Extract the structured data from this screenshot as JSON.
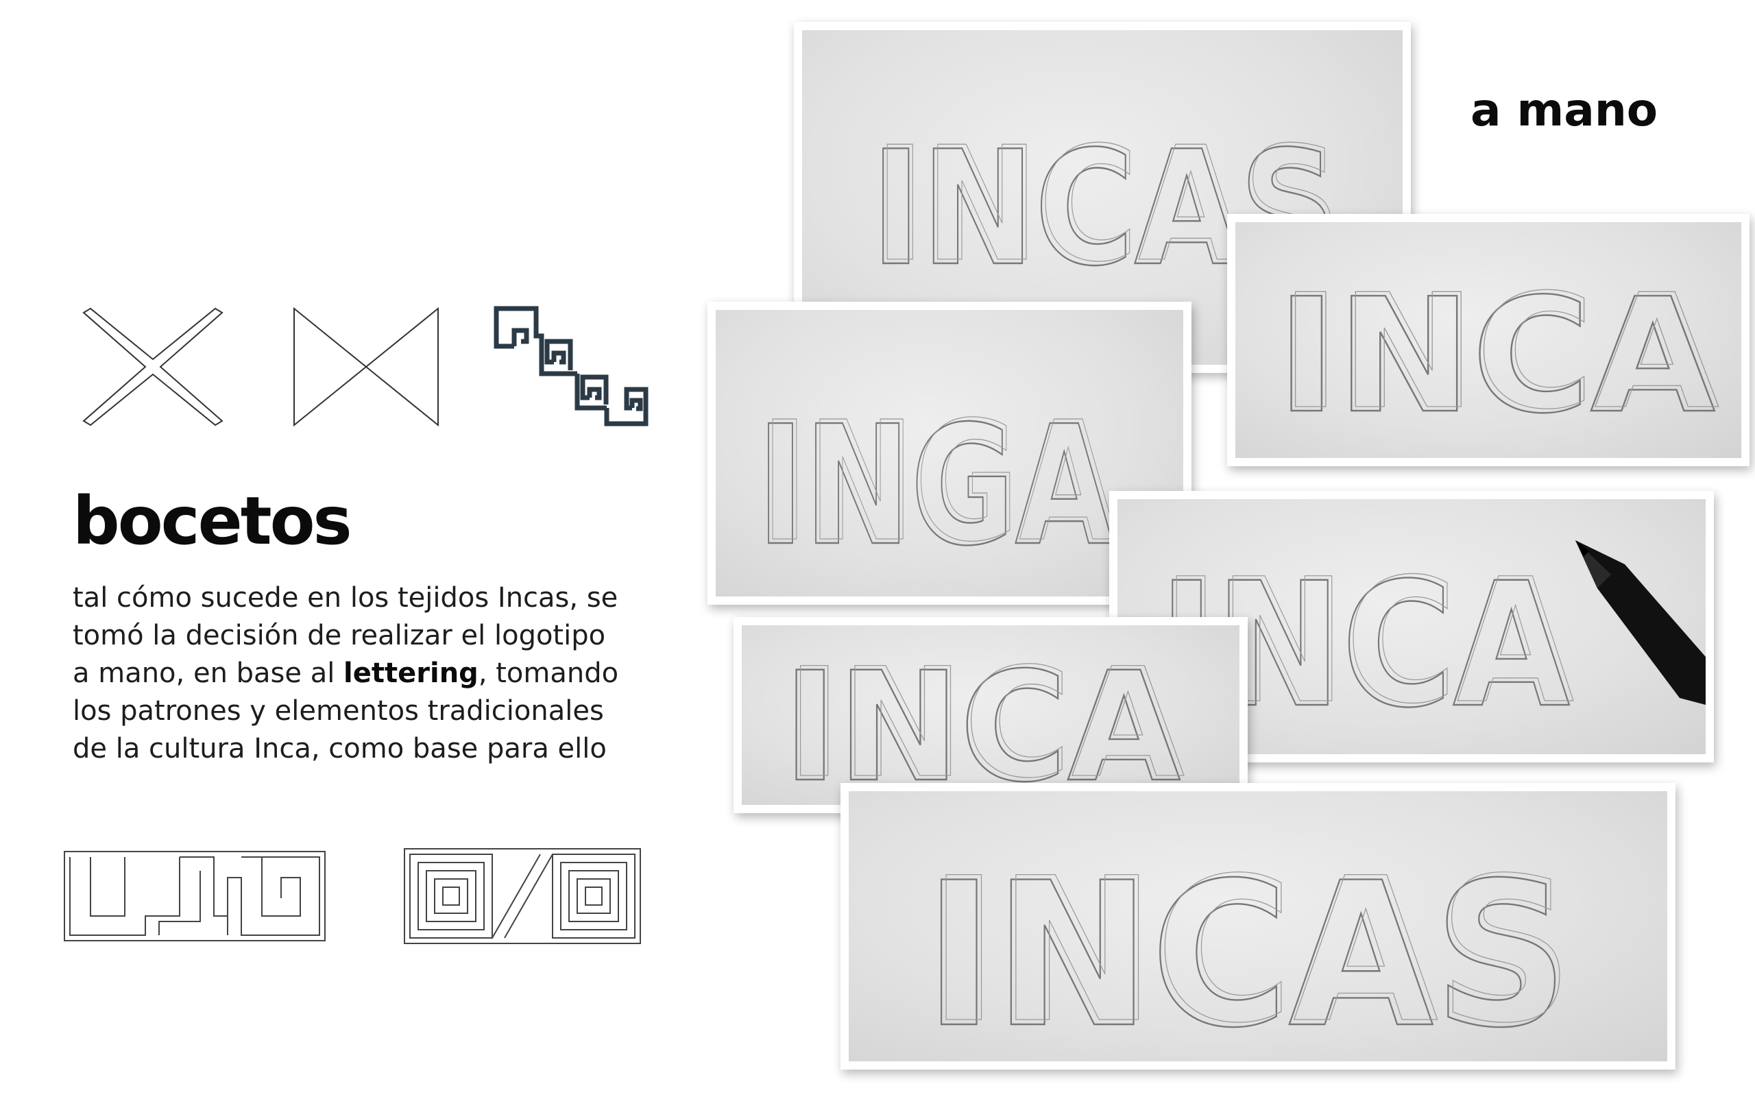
{
  "heading": "bocetos",
  "body": {
    "lines": [
      {
        "before": "tal cómo sucede en los tejidos Incas, se",
        "bold": "",
        "after": ""
      },
      {
        "before": "tomó la decisión de realizar el logotipo",
        "bold": "",
        "after": ""
      },
      {
        "before": "a mano, en base al ",
        "bold": "lettering",
        "after": ", tomando"
      },
      {
        "before": "los patrones y elementos tradicionales",
        "bold": "",
        "after": ""
      },
      {
        "before": "de la cultura Inca, como base para ello",
        "bold": "",
        "after": ""
      }
    ]
  },
  "corner_label": "a mano",
  "sketches": [
    {
      "id": "sketch-1",
      "word": "INCAS"
    },
    {
      "id": "sketch-2",
      "word": "INCA"
    },
    {
      "id": "sketch-3",
      "word": "INGA"
    },
    {
      "id": "sketch-4",
      "word": "INCA"
    },
    {
      "id": "sketch-5",
      "word": "INCA"
    },
    {
      "id": "sketch-6",
      "word": "INCAS"
    }
  ],
  "icons": [
    "cross-motif-icon",
    "bowtie-motif-icon",
    "spiral-step-motif-icon",
    "step-fret-motif-icon",
    "square-spiral-motif-icon",
    "pencil-icon"
  ],
  "colors": {
    "motif_dark": "#2b3a45",
    "ink": "#0b0b0b",
    "pencil": "#777777"
  }
}
